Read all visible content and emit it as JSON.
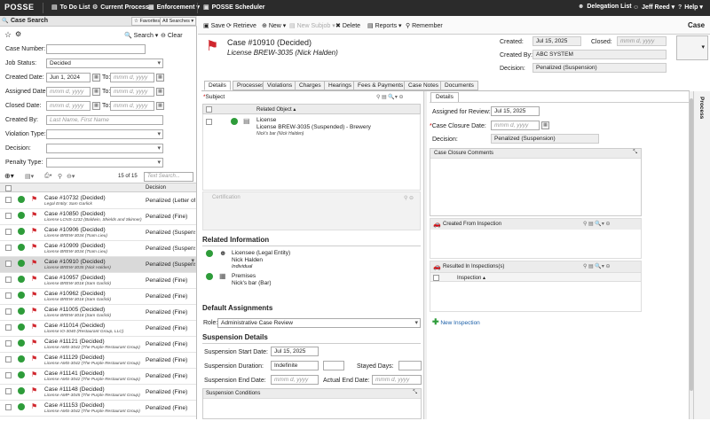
{
  "topbar": {
    "logo": "POSSE",
    "nav": [
      "To Do List",
      "Current Process",
      "Enforcement",
      "POSSE Scheduler"
    ],
    "right": [
      "Delegation List",
      "Jeff Reed",
      "Help"
    ]
  },
  "left": {
    "title": "Case Search",
    "favorites": "Favorites",
    "all_searches": "All Searches",
    "search_btn": "Search",
    "clear_btn": "Clear",
    "fields": {
      "case_number": {
        "label": "Case Number:",
        "value": ""
      },
      "job_status": {
        "label": "Job Status:",
        "value": "Decided"
      },
      "created_date": {
        "label": "Created Date:",
        "from": "Jun 1, 2024",
        "to_label": "To:",
        "to": "mmm d, yyyy"
      },
      "assigned_date": {
        "label": "Assigned Date:",
        "from": "mmm d, yyyy",
        "to_label": "To:",
        "to": "mmm d, yyyy"
      },
      "closed_date": {
        "label": "Closed Date:",
        "from": "mmm d, yyyy",
        "to_label": "To:",
        "to": "mmm d, yyyy"
      },
      "created_by": {
        "label": "Created By:",
        "placeholder": "Last Name, First Name"
      },
      "violation_type": {
        "label": "Violation Type:",
        "value": ""
      },
      "decision": {
        "label": "Decision:",
        "value": ""
      },
      "penalty_type": {
        "label": "Penalty Type:",
        "value": ""
      }
    },
    "count": "15 of 15",
    "text_search_placeholder": "Text Search...",
    "col_decision": "Decision",
    "rows": [
      {
        "title": "Case #10732 (Decided)",
        "sub": "Legal Entity: Sam Garlick",
        "decision": "Penalized (Letter of W"
      },
      {
        "title": "Case #10850 (Decided)",
        "sub": "License LCNS-1232 (Baldwin, Shields and Skinner)",
        "decision": "Penalized (Fine)"
      },
      {
        "title": "Case #10906 (Decided)",
        "sub": "License BREW-3034 (Tsam Lieu)",
        "decision": "Penalized (Suspensio"
      },
      {
        "title": "Case #10909 (Decided)",
        "sub": "License BREW-3034 (Tsam Lieu)",
        "decision": "Penalized (Suspensio"
      },
      {
        "title": "Case #10910 (Decided)",
        "sub": "License BREW-3035 (Nick Halden)",
        "decision": "Penalized (Suspensio"
      },
      {
        "title": "Case #10957 (Decided)",
        "sub": "License BREW-3018 (Sam Garlick)",
        "decision": "Penalized (Fine)"
      },
      {
        "title": "Case #10962 (Decided)",
        "sub": "License BREW-3018 (Sam Garlick)",
        "decision": "Penalized (Fine)"
      },
      {
        "title": "Case #11005 (Decided)",
        "sub": "License BREW-3018 (Sam Garlick)",
        "decision": "Penalized (Fine)"
      },
      {
        "title": "Case #11014 (Decided)",
        "sub": "License IO-3040 (Restaurant Group, LLC)",
        "decision": "Penalized (Fine)"
      },
      {
        "title": "Case #11121 (Decided)",
        "sub": "License AMS-3042 (The Purple Restaurant Group)",
        "decision": "Penalized (Fine)"
      },
      {
        "title": "Case #11129 (Decided)",
        "sub": "License AMS-3042 (The Purple Restaurant Group)",
        "decision": "Penalized (Fine)"
      },
      {
        "title": "Case #11141 (Decided)",
        "sub": "License AMS-3042 (The Purple Restaurant Group)",
        "decision": "Penalized (Fine)"
      },
      {
        "title": "Case #11148 (Decided)",
        "sub": "License AMP-3045 (The Purple Restaurant Group)",
        "decision": "Penalized (Fine)"
      },
      {
        "title": "Case #11153 (Decided)",
        "sub": "License AMS-3042 (The Purple Restaurant Group)",
        "decision": "Penalized (Fine)"
      }
    ]
  },
  "toolbar": {
    "save": "Save",
    "retrieve": "Retrieve",
    "new": "New",
    "new_subjob": "New Subjob",
    "delete": "Delete",
    "reports": "Reports",
    "remember": "Remember",
    "case": "Case"
  },
  "case": {
    "title": "Case #10910 (Decided)",
    "subtitle": "License BREW-3035 (Nick Halden)",
    "created_label": "Created:",
    "created": "Jul 15, 2025",
    "closed_label": "Closed:",
    "closed_ph": "mmm d, yyyy",
    "created_by_label": "Created By:",
    "created_by": "ABC SYSTEM",
    "decision_label": "Decision:",
    "decision": "Penalized (Suspension)"
  },
  "tabs": [
    "Details",
    "Processes",
    "Violations",
    "Charges",
    "Hearings",
    "Fees & Payments",
    "Case Notes",
    "Documents"
  ],
  "subject": {
    "label": "Subject",
    "col": "Related Object",
    "item_type": "License",
    "item_name": "License BREW-3035 (Suspended) - Brewery",
    "item_sub": "Nick's bar (Nick Halden)"
  },
  "certification": "Certification",
  "related": {
    "title": "Related Information",
    "items": [
      {
        "type": "Licensee (Legal Entity)",
        "name": "Nick Halden",
        "sub": "Individual"
      },
      {
        "type": "Premises",
        "name": "Nick's bar (Bar)",
        "sub": ""
      }
    ]
  },
  "assignments": {
    "title": "Default Assignments",
    "role_label": "Role:",
    "role": "Administrative Case Review"
  },
  "suspension": {
    "title": "Suspension Details",
    "start_label": "Suspension Start Date:",
    "start": "Jul 15, 2025",
    "duration_label": "Suspension Duration:",
    "duration": "Indefinite",
    "stayed_label": "Stayed Days:",
    "end_label": "Suspension End Date:",
    "end_ph": "mmm d, yyyy",
    "actual_label": "Actual End Date:",
    "actual_ph": "mmm d, yyyy",
    "conditions": "Suspension Conditions"
  },
  "details": {
    "tab": "Details",
    "assigned_review_label": "Assigned for Review:",
    "assigned_review": "Jul 15, 2025",
    "closure_label": "*Case Closure Date:",
    "closure_ph": "mmm d, yyyy",
    "decision_label": "Decision:",
    "decision": "Penalized (Suspension)",
    "comments": "Case Closure Comments",
    "created_from": "Created From Inspection",
    "resulted_in": "Resulted In Inspections(s)",
    "inspection_col": "Inspection",
    "new_inspection": "New Inspection"
  },
  "process_sidebar": "Process",
  "colors": {
    "topbar": "#2b2b2b",
    "flag": "#d0262d",
    "go": "#2e9c3a",
    "link": "#1a5fa8"
  }
}
